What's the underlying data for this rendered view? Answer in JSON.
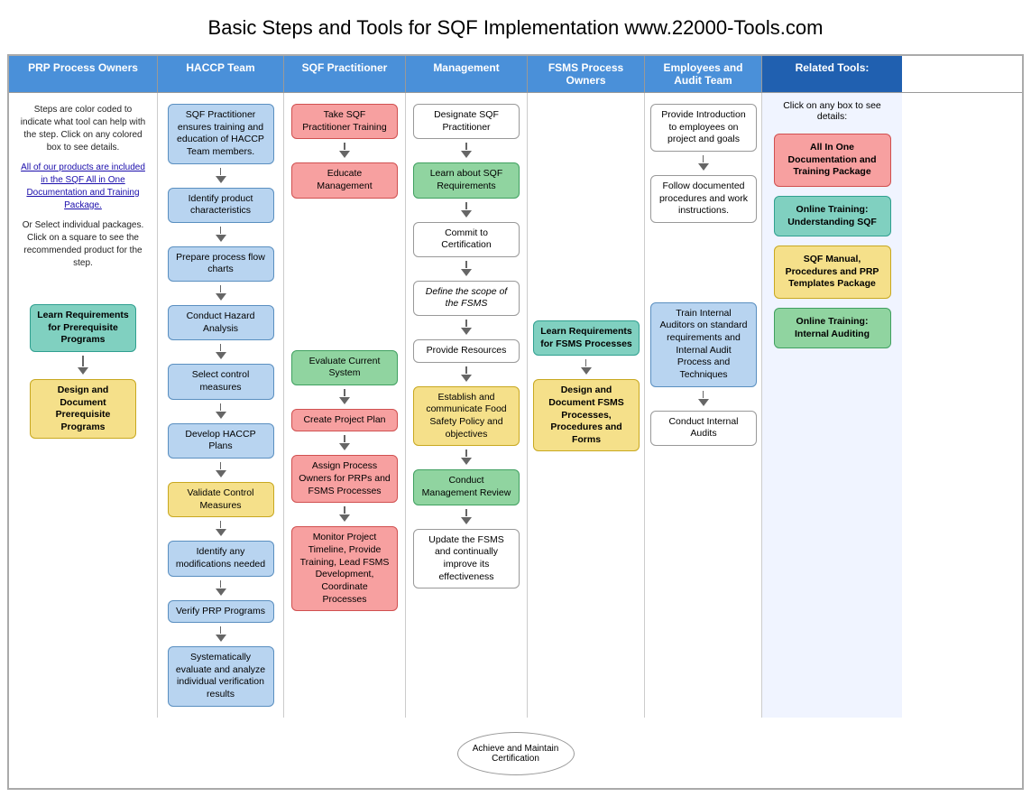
{
  "page": {
    "title": "Basic Steps and Tools for SQF Implementation www.22000-Tools.com"
  },
  "headers": {
    "prp": "PRP Process Owners",
    "haccp": "HACCP Team",
    "sqf": "SQF Practitioner",
    "mgmt": "Management",
    "fsms": "FSMS Process Owners",
    "emp": "Employees and Audit Team",
    "tools": "Related Tools:"
  },
  "prp_col": {
    "sidebar_text": "Steps are color coded to indicate what tool can help with the step. Click on any colored box to see details.",
    "link_text": "All of our products are included in the SQF All in One Documentation and Training Package.",
    "or_text": "Or Select individual packages. Click on a square to see the recommended product for the step.",
    "box1": "Learn Requirements for Prerequisite Programs",
    "box2": "Design and Document Prerequisite Programs"
  },
  "haccp_col": {
    "box1": "SQF Practitioner ensures training and education of HACCP Team members.",
    "box2": "Identify product characteristics",
    "box3": "Prepare process flow charts",
    "box4": "Conduct Hazard Analysis",
    "box5": "Select control measures",
    "box6": "Develop HACCP Plans",
    "box7": "Validate Control Measures",
    "box8": "Identify any modifications needed",
    "box9": "Verify PRP Programs",
    "box10": "Systematically evaluate and analyze individual verification results"
  },
  "sqf_col": {
    "box1": "Take SQF Practitioner Training",
    "box2": "Educate Management",
    "box3": "Evaluate Current System",
    "box4": "Create Project Plan",
    "box5": "Assign Process Owners for PRPs and FSMS Processes",
    "box6": "Monitor Project Timeline, Provide Training, Lead FSMS Development, Coordinate Processes"
  },
  "mgmt_col": {
    "box1": "Designate SQF Practitioner",
    "box2": "Learn about SQF Requirements",
    "box3": "Commit to Certification",
    "box4": "Define the scope of the FSMS",
    "box5": "Provide Resources",
    "box6": "Establish and communicate Food Safety Policy and objectives",
    "box7": "Conduct Management Review",
    "box8": "Update the FSMS and continually improve its effectiveness"
  },
  "fsms_col": {
    "box1": "Learn Requirements for FSMS Processes",
    "box2": "Design and Document FSMS Processes, Procedures and Forms"
  },
  "emp_col": {
    "box1": "Provide Introduction to employees on project and goals",
    "box2": "Follow documented procedures and work instructions.",
    "box3": "Train Internal Auditors on standard requirements and Internal Audit Process and Techniques",
    "box4": "Conduct Internal Audits"
  },
  "tools_col": {
    "intro": "Click on any box to see details:",
    "tool1": "All In One Documentation and Training Package",
    "tool2": "Online Training: Understanding SQF",
    "tool3": "SQF Manual, Procedures and PRP Templates Package",
    "tool4": "Online Training: Internal Auditing"
  },
  "bottom": {
    "oval": "Achieve and Maintain Certification"
  }
}
